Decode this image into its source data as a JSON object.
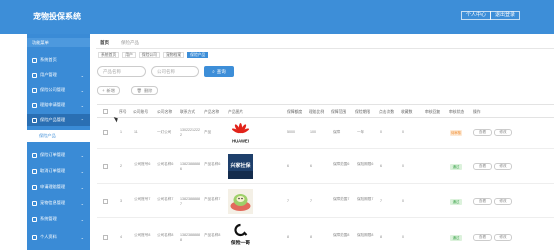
{
  "header": {
    "title": "宠物投保系统",
    "user_button": "个人中心",
    "exit_button": "退出登录"
  },
  "sidebar": {
    "top_label": "功能菜单",
    "items": [
      {
        "label": "系统首页"
      },
      {
        "label": "用户管理"
      },
      {
        "label": "保险公司管理"
      },
      {
        "label": "理赔申请管理"
      },
      {
        "label": "保险产品管理"
      },
      {
        "label": "保险产品"
      },
      {
        "label": "保险订单管理"
      },
      {
        "label": "取消订单管理"
      },
      {
        "label": "申请理赔管理"
      },
      {
        "label": "宠物信息管理"
      },
      {
        "label": "系统管理"
      },
      {
        "label": "个人资料"
      }
    ]
  },
  "tabs": [
    {
      "label": "首页"
    },
    {
      "label": "保险产品"
    }
  ],
  "breadcrumb": [
    "系统首页",
    "用户",
    "保险公司",
    "宠物档案",
    "保险产品"
  ],
  "search": {
    "product_placeholder": "产品名称",
    "company_placeholder": "公司名称",
    "button": "查询"
  },
  "actions": {
    "add": "新增",
    "delete": "删除"
  },
  "table": {
    "headers": [
      "序号",
      "公司账号",
      "公司名称",
      "联系方式",
      "产品名称",
      "产品图片",
      "保障额度",
      "理赔比例",
      "保障范围",
      "保险期限",
      "点击次数",
      "收藏数",
      "审核回复",
      "审核状态",
      "操作"
    ],
    "rows": [
      {
        "index": "1",
        "company_account": "11",
        "company_name": "一灯公司",
        "contact": "13022212222",
        "product_name": "产品",
        "logo": "HUAWEI",
        "amount": "5000",
        "ratio": "100",
        "scope": "保障",
        "period": "一年",
        "clicks": "0",
        "favorites": "0",
        "reply": "",
        "status": "待审核",
        "status_color": "#f08c2e",
        "view": "查看",
        "edit": "修改"
      },
      {
        "index": "2",
        "company_account": "公司账号6",
        "company_name": "公司名称6",
        "contact": "13823888886",
        "product_name": "产品名称6",
        "logo": "兴家社保",
        "amount": "6",
        "ratio": "6",
        "scope": "保障范围6",
        "period": "保险期限6",
        "clicks": "6",
        "favorites": "0",
        "reply": "",
        "status": "通过",
        "status_color": "#3aa34a",
        "view": "查看",
        "edit": "修改"
      },
      {
        "index": "3",
        "company_account": "公司账号7",
        "company_name": "公司名称7",
        "contact": "13823888887",
        "product_name": "产品名称7",
        "logo": "",
        "amount": "7",
        "ratio": "7",
        "scope": "保障范围7",
        "period": "保险期限7",
        "clicks": "7",
        "favorites": "0",
        "reply": "",
        "status": "通过",
        "status_color": "#3aa34a",
        "view": "查看",
        "edit": "修改"
      },
      {
        "index": "4",
        "company_account": "公司账号8",
        "company_name": "公司名称8",
        "contact": "13823888888",
        "product_name": "产品名称8",
        "logo": "保险一哥",
        "amount": "8",
        "ratio": "8",
        "scope": "保障范围8",
        "period": "保险期限8",
        "clicks": "8",
        "favorites": "0",
        "reply": "",
        "status": "通过",
        "status_color": "#3aa34a",
        "view": "查看",
        "edit": "修改"
      }
    ]
  }
}
